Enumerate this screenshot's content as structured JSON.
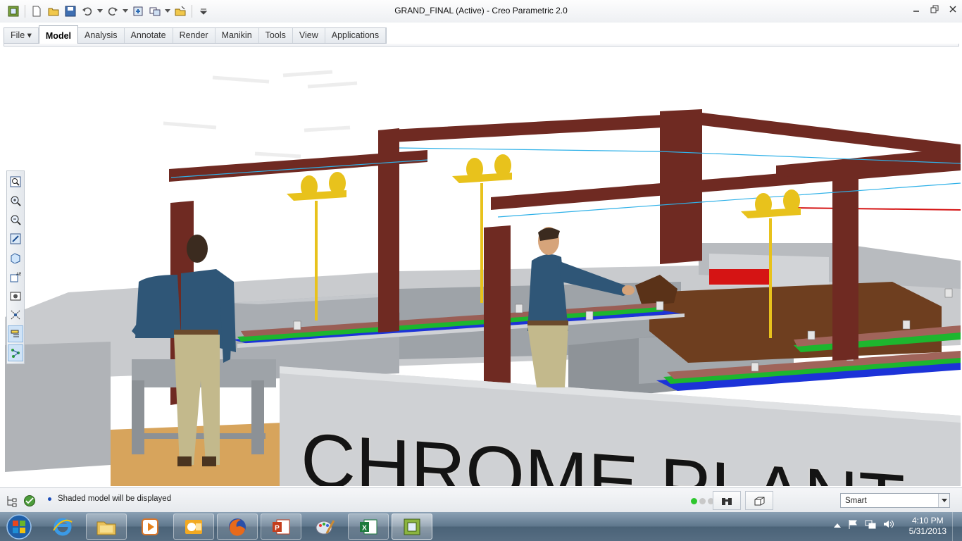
{
  "window": {
    "title": "GRAND_FINAL (Active) - Creo Parametric 2.0"
  },
  "quick_access": [
    "new-icon",
    "open-icon",
    "save-icon",
    "undo-icon",
    "redo-icon",
    "regenerate-icon",
    "windows-icon",
    "close-window-icon",
    "customize-icon"
  ],
  "ribbon": {
    "tabs": [
      {
        "label": "File ▾",
        "active": false
      },
      {
        "label": "Model",
        "active": true
      },
      {
        "label": "Analysis",
        "active": false
      },
      {
        "label": "Annotate",
        "active": false
      },
      {
        "label": "Render",
        "active": false
      },
      {
        "label": "Manikin",
        "active": false
      },
      {
        "label": "Tools",
        "active": false
      },
      {
        "label": "View",
        "active": false
      },
      {
        "label": "Applications",
        "active": false
      }
    ]
  },
  "scene": {
    "sign_text": "CHROME PLANT",
    "colors": {
      "frame": "#6f2a22",
      "crane": "#e8c21c",
      "tank": "#a7abb0",
      "rack_green": "#1db62e",
      "rack_blue": "#1c33d8",
      "shirt": "#2f5677",
      "pants": "#c3b98c",
      "floor": "#d7a45c"
    }
  },
  "view_toolbar": [
    "refit-icon",
    "zoom-in-icon",
    "zoom-out-icon",
    "repaint-icon",
    "display-style-icon",
    "saved-views-icon",
    "view-manager-icon",
    "datum-display-icon",
    "annotation-display-icon",
    "spin-center-icon"
  ],
  "status": {
    "message": "Shaded model will be displayed",
    "filter_value": "Smart"
  },
  "taskbar": {
    "time": "4:10 PM",
    "date": "5/31/2013"
  }
}
